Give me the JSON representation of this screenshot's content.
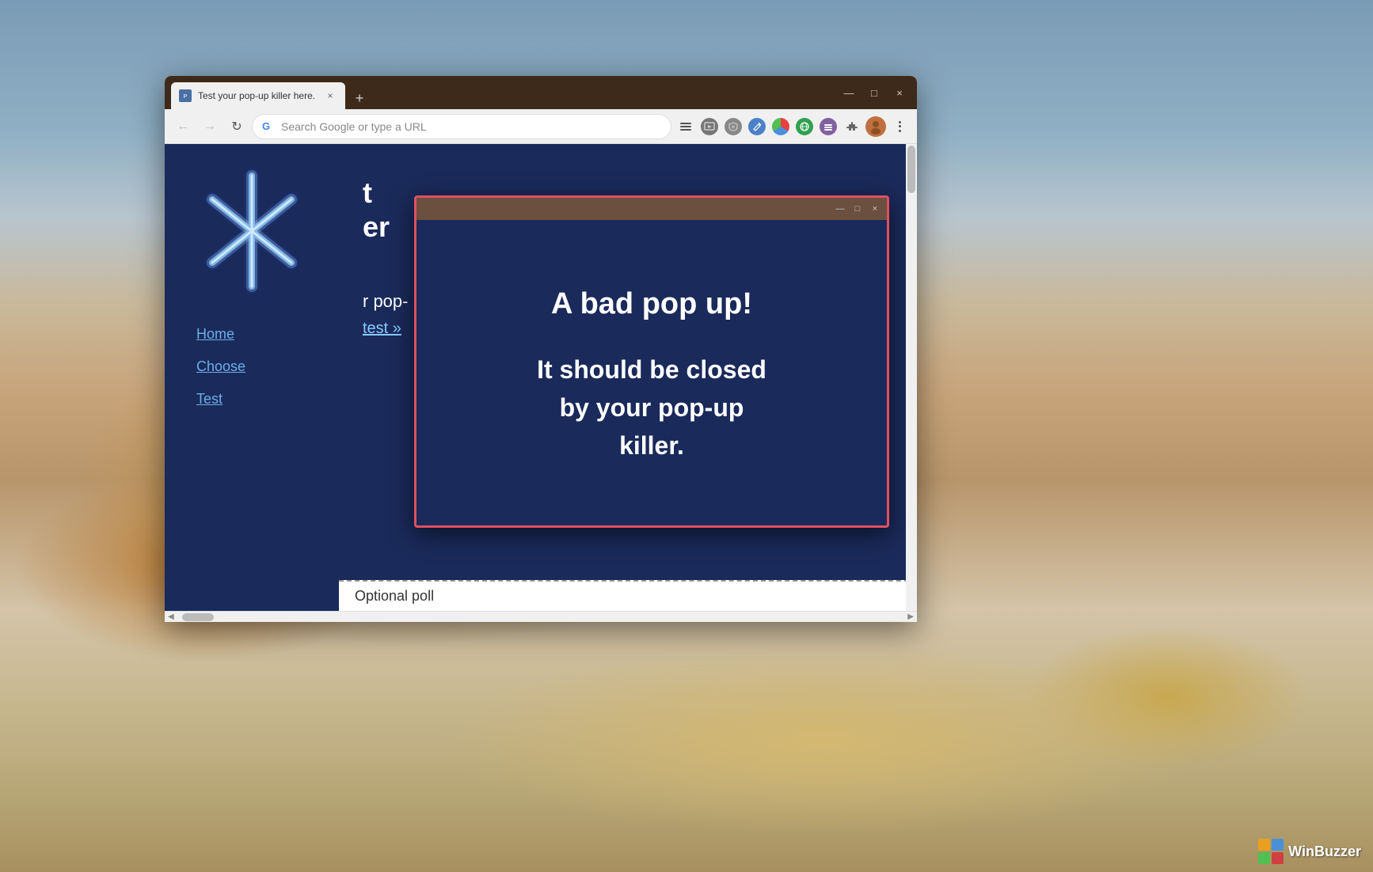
{
  "desktop": {
    "winbuzzer_label": "WinBuzzer"
  },
  "browser": {
    "tab": {
      "title": "Test your pop-up killer here.",
      "close_label": "×"
    },
    "new_tab_label": "+",
    "window_controls": {
      "minimize": "—",
      "maximize": "□",
      "close": "×"
    },
    "toolbar": {
      "back_icon": "←",
      "forward_icon": "→",
      "reload_icon": "↻",
      "address_placeholder": "Search Google or type a URL",
      "more_icon": "⋯",
      "extension_icon": "🧩",
      "account_icon": "👤"
    }
  },
  "site": {
    "nav": {
      "home": "Home",
      "choose": "Choose",
      "test": "Test"
    },
    "main_text_line1": "t",
    "main_text_line2": "er",
    "popup_text": "r pop-",
    "test_link": "test »",
    "optional_poll_label": "Optional poll"
  },
  "popup": {
    "title": "A bad pop up!",
    "body_line1": "It should be closed",
    "body_line2": "by your pop-up",
    "body_line3": "killer.",
    "controls": {
      "minimize": "—",
      "maximize": "□",
      "close": "×"
    }
  }
}
